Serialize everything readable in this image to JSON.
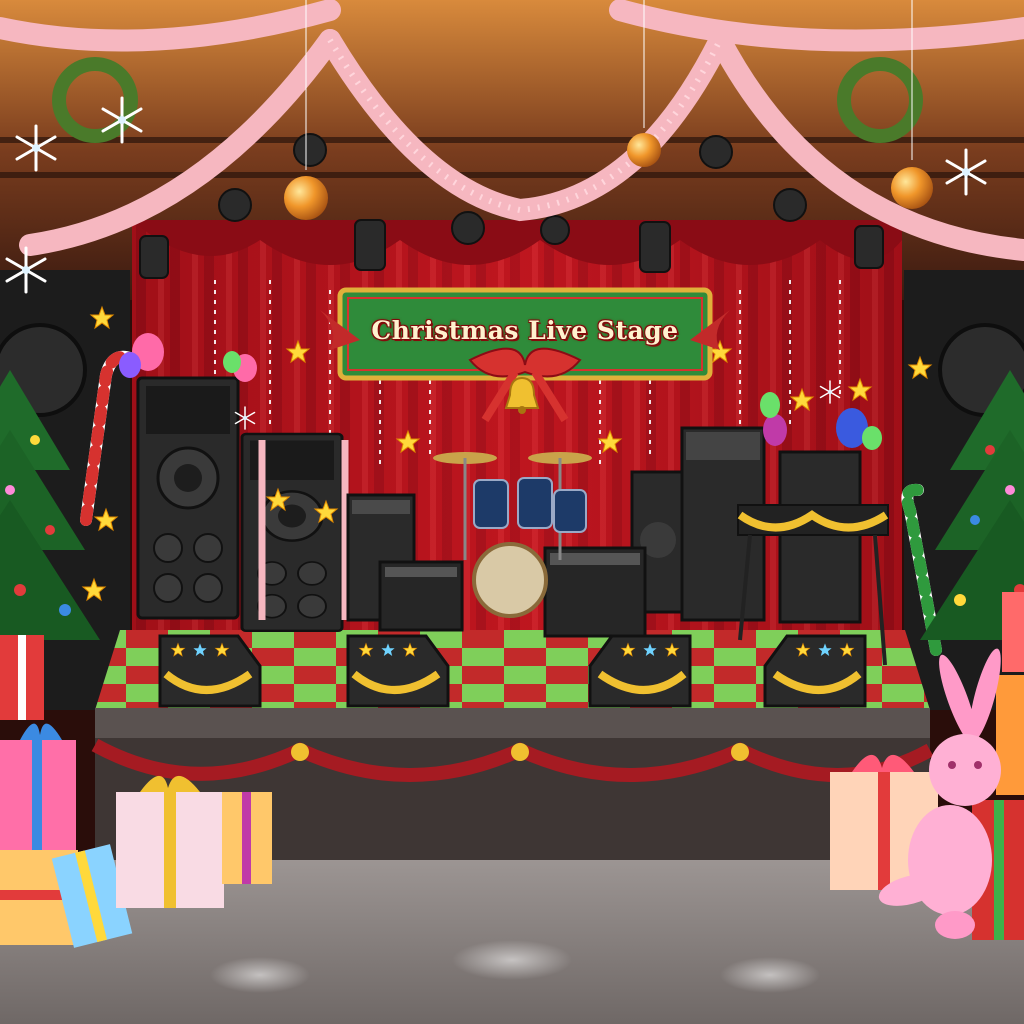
{
  "scene": {
    "banner": {
      "text": "Christmas Live Stage"
    },
    "palette": {
      "curtain": "#b5121b",
      "curtain_dark": "#6e0810",
      "floor_red": "#c22a2a",
      "floor_green": "#7fcf5a",
      "garland_pink": "#f6b7c0",
      "banner_green": "#2f8b3a",
      "ceiling": "#3a1a10",
      "hall_floor": "#8c8583"
    },
    "icons": [
      "snowflake-icon",
      "star-icon",
      "bell-icon",
      "ornament-icon",
      "wreath-icon",
      "gift-icon",
      "candy-cane-icon",
      "balloon-icon",
      "bunny-plush-icon",
      "christmas-tree-icon",
      "drum-kit-icon",
      "speaker-icon",
      "amplifier-icon",
      "spotlight-icon"
    ]
  }
}
